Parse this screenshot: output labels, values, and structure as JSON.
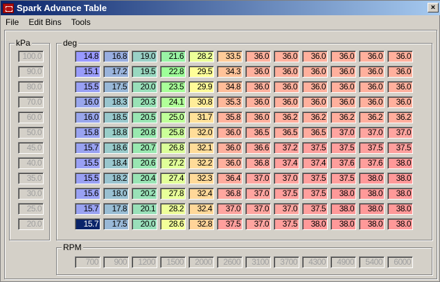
{
  "window": {
    "title": "Spark Advance Table",
    "close": "×"
  },
  "menu": [
    "File",
    "Edit Bins",
    "Tools"
  ],
  "kpa": {
    "label": "kPa",
    "bins": [
      "100.0",
      "90.0",
      "80.0",
      "70.0",
      "60.0",
      "50.0",
      "45.0",
      "40.0",
      "35.0",
      "30.0",
      "25.0",
      "20.0"
    ]
  },
  "rpm": {
    "label": "RPM",
    "bins": [
      "700",
      "900",
      "1200",
      "1500",
      "2000",
      "2600",
      "3100",
      "3700",
      "4300",
      "4900",
      "5400",
      "6000"
    ]
  },
  "table": {
    "label": "deg",
    "selected": [
      11,
      0
    ],
    "rows": [
      [
        "14.8",
        "16.8",
        "19.0",
        "21.6",
        "28.2",
        "33.5",
        "36.0",
        "36.0",
        "36.0",
        "36.0",
        "36.0",
        "36.0"
      ],
      [
        "15.1",
        "17.2",
        "19.5",
        "22.8",
        "29.5",
        "34.3",
        "36.0",
        "36.0",
        "36.0",
        "36.0",
        "36.0",
        "36.0"
      ],
      [
        "15.5",
        "17.5",
        "20.0",
        "23.5",
        "29.9",
        "34.8",
        "36.0",
        "36.0",
        "36.0",
        "36.0",
        "36.0",
        "36.0"
      ],
      [
        "16.0",
        "18.3",
        "20.3",
        "24.1",
        "30.8",
        "35.3",
        "36.0",
        "36.0",
        "36.0",
        "36.0",
        "36.0",
        "36.0"
      ],
      [
        "16.0",
        "18.5",
        "20.5",
        "25.0",
        "31.7",
        "35.8",
        "36.0",
        "36.2",
        "36.2",
        "36.2",
        "36.2",
        "36.2"
      ],
      [
        "15.8",
        "18.8",
        "20.8",
        "25.8",
        "32.0",
        "36.0",
        "36.5",
        "36.5",
        "36.5",
        "37.0",
        "37.0",
        "37.0"
      ],
      [
        "15.7",
        "18.6",
        "20.7",
        "26.8",
        "32.1",
        "36.0",
        "36.6",
        "37.2",
        "37.5",
        "37.5",
        "37.5",
        "37.5"
      ],
      [
        "15.5",
        "18.4",
        "20.6",
        "27.2",
        "32.2",
        "36.0",
        "36.8",
        "37.4",
        "37.4",
        "37.6",
        "37.6",
        "38.0"
      ],
      [
        "15.5",
        "18.2",
        "20.4",
        "27.4",
        "32.3",
        "36.4",
        "37.0",
        "37.0",
        "37.5",
        "37.5",
        "38.0",
        "38.0"
      ],
      [
        "15.6",
        "18.0",
        "20.2",
        "27.8",
        "32.4",
        "36.8",
        "37.0",
        "37.5",
        "37.5",
        "38.0",
        "38.0",
        "38.0"
      ],
      [
        "15.7",
        "17.8",
        "20.1",
        "28.2",
        "32.4",
        "37.0",
        "37.0",
        "37.0",
        "37.5",
        "38.0",
        "38.0",
        "38.0"
      ],
      [
        "15.7",
        "17.5",
        "20.0",
        "28.6",
        "32.8",
        "37.5",
        "37.0",
        "37.5",
        "38.0",
        "38.0",
        "38.0",
        "38.0"
      ]
    ]
  }
}
